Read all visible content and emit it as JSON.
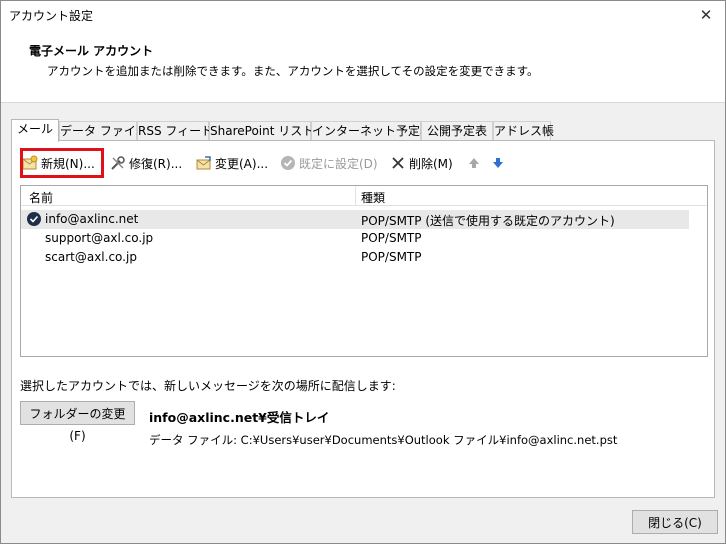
{
  "window": {
    "title": "アカウント設定",
    "close_glyph": "✕"
  },
  "header": {
    "title": "電子メール アカウント",
    "description": "アカウントを追加または削除できます。また、アカウントを選択してその設定を変更できます。"
  },
  "tabs": [
    {
      "label": "メール",
      "active": true
    },
    {
      "label": "データ ファイル"
    },
    {
      "label": "RSS フィード"
    },
    {
      "label": "SharePoint リスト"
    },
    {
      "label": "インターネット予定表"
    },
    {
      "label": "公開予定表"
    },
    {
      "label": "アドレス帳"
    }
  ],
  "toolbar": {
    "new_label": "新規(N)...",
    "repair_label": "修復(R)...",
    "change_label": "変更(A)...",
    "set_default_label": "既定に設定(D)",
    "delete_label": "削除(M)",
    "move_up_icon": "arrow-up-icon",
    "move_down_icon": "arrow-down-icon"
  },
  "accounts_list": {
    "columns": {
      "name": "名前",
      "type": "種類"
    },
    "rows": [
      {
        "name": "info@axlinc.net",
        "type": "POP/SMTP (送信で使用する既定のアカウント)",
        "default": true
      },
      {
        "name": "support@axl.co.jp",
        "type": "POP/SMTP"
      },
      {
        "name": "scart@axl.co.jp",
        "type": "POP/SMTP"
      }
    ]
  },
  "delivery": {
    "text": "選択したアカウントでは、新しいメッセージを次の場所に配信します:",
    "change_folder_label": "フォルダーの変更(F)",
    "location": "info@axlinc.net¥受信トレイ",
    "data_file": "データ ファイル: C:¥Users¥user¥Documents¥Outlook ファイル¥info@axlinc.net.pst"
  },
  "footer": {
    "close_label": "閉じる(C)"
  },
  "colors": {
    "highlight": "#e0101a",
    "up_arrow": "#a8a8a8",
    "down_arrow": "#2f6fd6"
  }
}
